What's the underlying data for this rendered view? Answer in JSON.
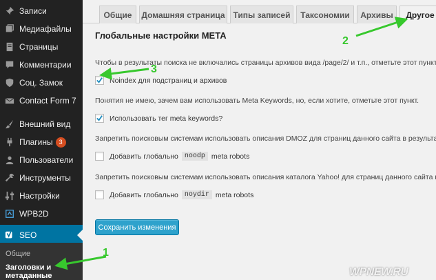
{
  "sidebar": {
    "items": [
      {
        "label": "Записи",
        "icon": "pin-icon"
      },
      {
        "label": "Медиафайлы",
        "icon": "media-icon"
      },
      {
        "label": "Страницы",
        "icon": "pages-icon"
      },
      {
        "label": "Комментарии",
        "icon": "comment-icon"
      },
      {
        "label": "Соц. Замок",
        "icon": "lock-shield-icon"
      },
      {
        "label": "Contact Form 7",
        "icon": "mail-icon"
      },
      {
        "label": "Внешний вид",
        "icon": "brush-icon"
      },
      {
        "label": "Плагины",
        "icon": "plug-icon",
        "badge": "3"
      },
      {
        "label": "Пользователи",
        "icon": "users-icon"
      },
      {
        "label": "Инструменты",
        "icon": "wrench-icon"
      },
      {
        "label": "Настройки",
        "icon": "settings-icon"
      },
      {
        "label": "WPB2D",
        "icon": "wpb2d-icon"
      },
      {
        "label": "SEO",
        "icon": "yoast-icon"
      }
    ],
    "submenu": {
      "general": "Общие",
      "titles_line1": "Заголовки и",
      "titles_line2": "метаданные"
    }
  },
  "tabs": [
    {
      "label": "Общие"
    },
    {
      "label": "Домашняя страница"
    },
    {
      "label": "Типы записей"
    },
    {
      "label": "Таксономии"
    },
    {
      "label": "Архивы"
    },
    {
      "label": "Другое"
    }
  ],
  "active_tab": "Другое",
  "main": {
    "section_title": "Глобальные настройки META",
    "para1": "Чтобы в результаты поиска не включались страницы архивов вида /page/2/ и т.п., отметьте этот пункт.",
    "noindex_label": "Noindex для подстраниц и архивов",
    "noindex_checked": true,
    "para2": "Понятия не имею, зачем вам использовать Meta Keywords, но, если хотите, отметьте этот пункт.",
    "keywords_label": "Использовать тег meta keywords?",
    "keywords_checked": true,
    "para3": "Запретить поисковым системам использовать описания DMOZ для страниц данного сайта в результатах",
    "noodp_prefix": "Добавить глобально",
    "noodp_code": "noodp",
    "noodp_suffix": "meta robots",
    "noodp_checked": false,
    "para4": "Запретить поисковым системам использовать описания каталога Yahoo! для страниц данного сайта в р",
    "noydir_prefix": "Добавить глобально",
    "noydir_code": "noydir",
    "noydir_suffix": "meta robots",
    "noydir_checked": false,
    "save_label": "Сохранить изменения"
  },
  "annotations": {
    "n1": "1",
    "n2": "2",
    "n3": "3",
    "color": "#37c82d"
  },
  "watermark": "WPNEW.RU",
  "colors": {
    "sidebar_bg": "#222222",
    "active_menu": "#0074a2",
    "button": "#2ea2cc",
    "badge": "#d54e21"
  }
}
